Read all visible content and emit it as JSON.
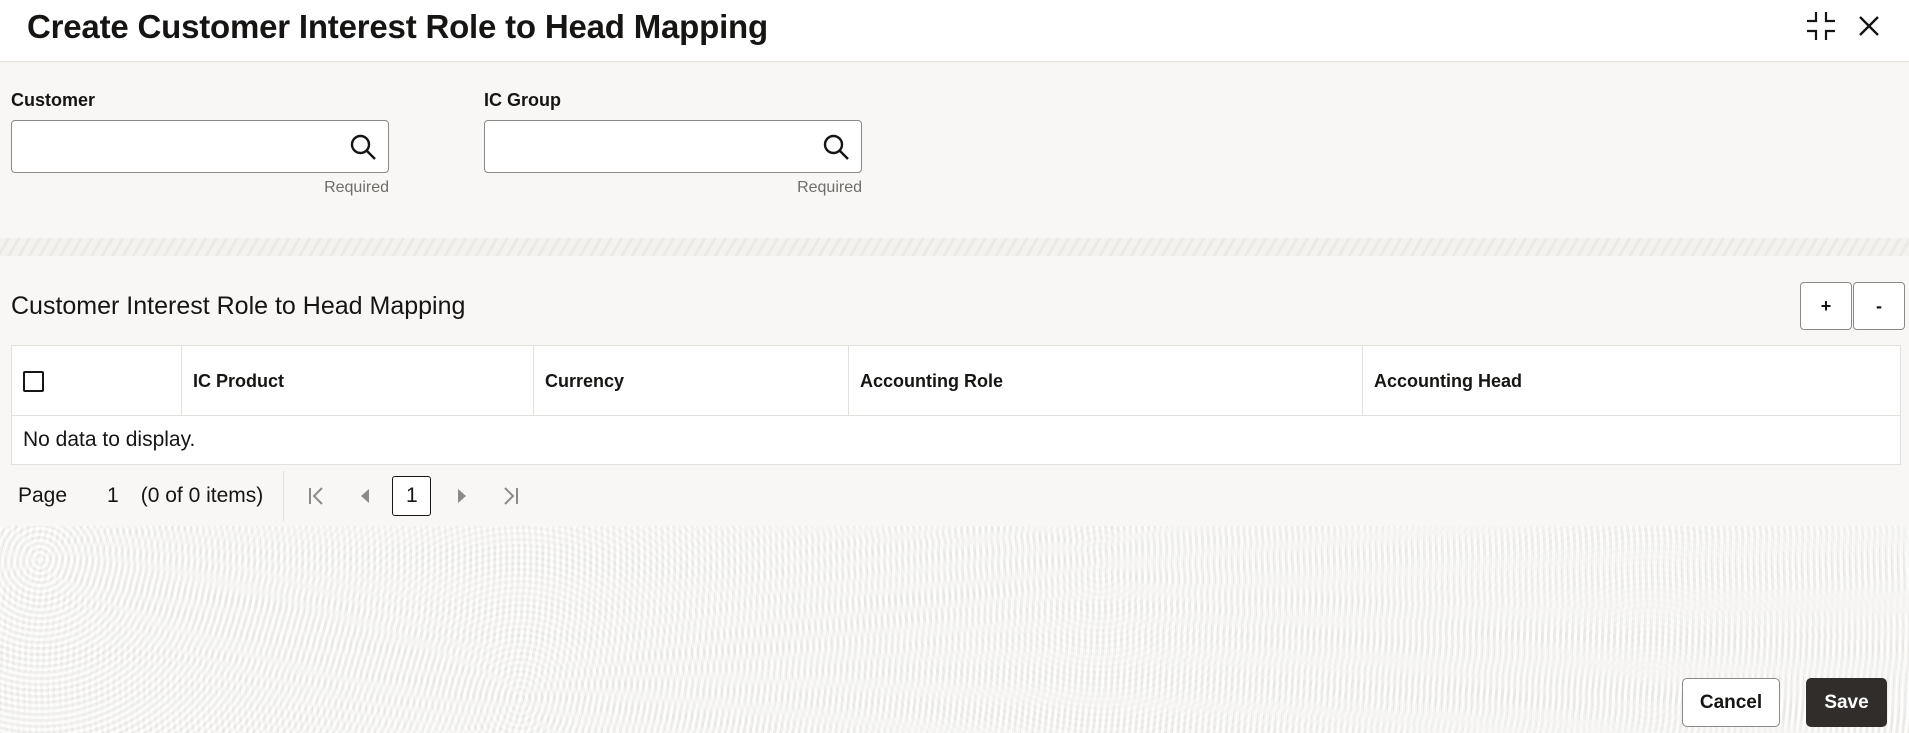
{
  "header": {
    "title": "Create Customer Interest Role to Head Mapping"
  },
  "form": {
    "customer": {
      "label": "Customer",
      "value": "",
      "helper": "Required"
    },
    "ic_group": {
      "label": "IC Group",
      "value": "",
      "helper": "Required"
    }
  },
  "grid": {
    "title": "Customer Interest Role to Head Mapping",
    "add_label": "+",
    "remove_label": "-",
    "columns": [
      "IC Product",
      "Currency",
      "Accounting Role",
      "Accounting Head"
    ],
    "empty_text": "No data to display.",
    "pager": {
      "page_label": "Page",
      "page_number": "1",
      "item_count": "(0 of 0 items)",
      "current_page": "1"
    }
  },
  "footer": {
    "cancel_label": "Cancel",
    "save_label": "Save"
  },
  "colors": {
    "primary_button": "#312d2a",
    "text": "#161513",
    "border": "#8c8a87"
  }
}
